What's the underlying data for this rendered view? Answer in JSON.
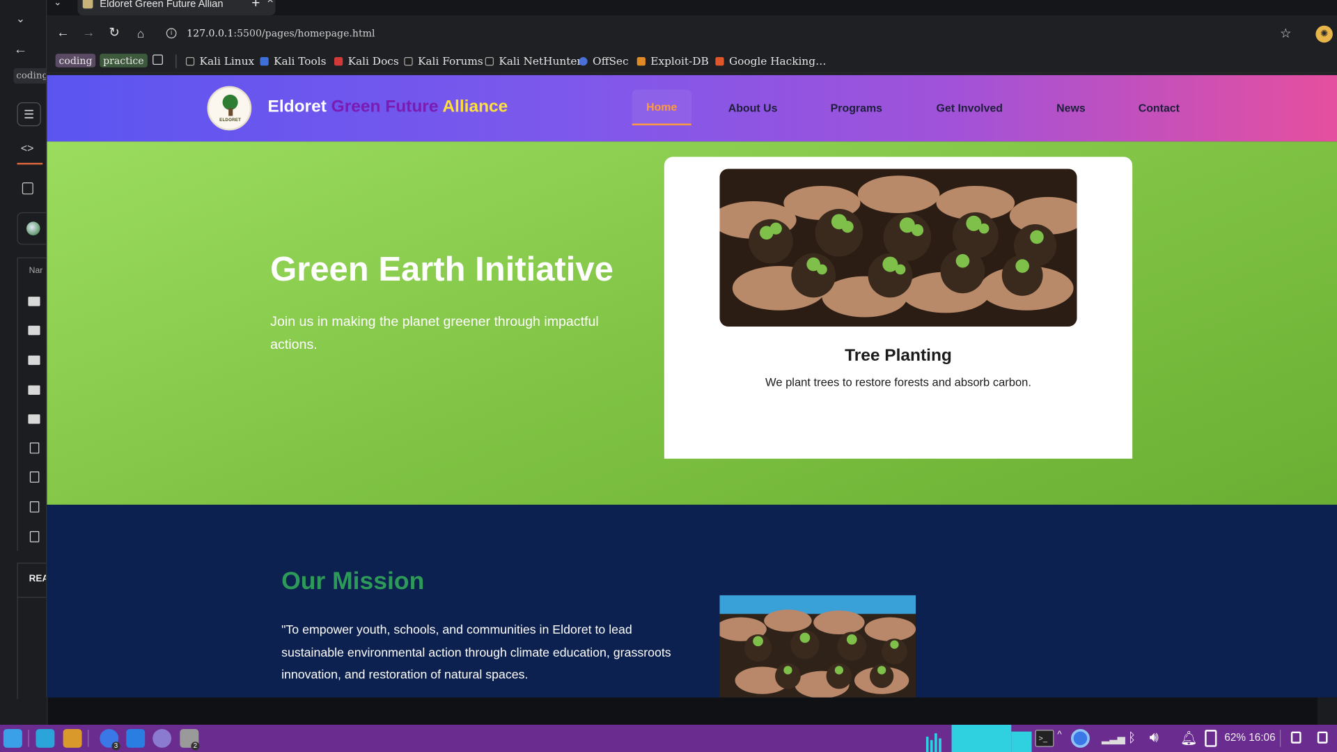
{
  "browser": {
    "tab_title": "Eldoret Green Future Allian",
    "url_host": "127.0.0.1",
    "url_path": ":5500/pages/homepage.html",
    "bookmarks_folders": [
      "coding",
      "practice"
    ],
    "bookmarks": [
      "Kali Linux",
      "Kali Tools",
      "Kali Docs",
      "Kali Forums",
      "Kali NetHunter",
      "OffSec",
      "Exploit-DB",
      "Google Hacking…"
    ]
  },
  "editor": {
    "explorer_header": "Nar",
    "section_label": "REA",
    "tab_label": "coding"
  },
  "site": {
    "logo_text": "ELDORET",
    "brand_part1": "Eldoret",
    "brand_part2": "Green Future",
    "brand_part3": "Alliance",
    "nav": [
      "Home",
      "About Us",
      "Programs",
      "Get Involved",
      "News",
      "Contact"
    ],
    "hero_title": "Green Earth Initiative",
    "hero_subtitle": "Join us in making the planet greener through impactful actions.",
    "card_title": "Tree Planting",
    "card_text": "We plant trees to restore forests and absorb carbon.",
    "mission_title": "Our Mission",
    "mission_text": "\"To empower youth, schools, and communities in Eldoret to lead sustainable environmental action through climate education, grassroots innovation, and restoration of natural spaces."
  },
  "taskbar": {
    "battery": "62%",
    "time": "16:06",
    "badges": [
      "3",
      "2"
    ]
  },
  "colors": {
    "header_start": "#5b55f0",
    "header_end": "#e64f9e",
    "hero_green": "#8ccf52",
    "mission_bg": "#0c214f",
    "brand_purple": "#7a1bb3",
    "brand_yellow": "#ffe03a",
    "nav_active": "#ff9a3d",
    "taskbar": "#6a2c8e"
  }
}
